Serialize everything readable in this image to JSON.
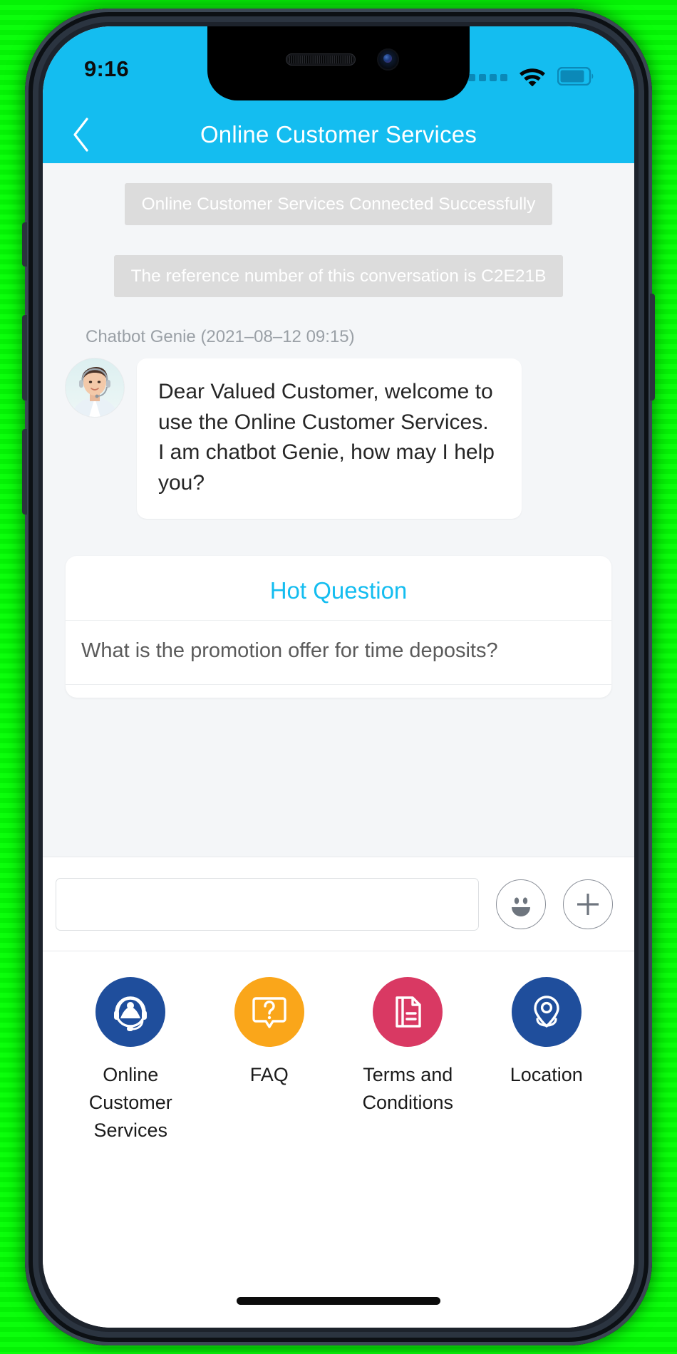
{
  "colors": {
    "brand": "#14bdf0",
    "brand_hot": "#14bdf0",
    "sys_pill_bg": "#dcdcdc",
    "chat_bg": "#f4f6f8",
    "tool_blue": "#1f4e9c",
    "tool_orange": "#faa61a",
    "tool_pink": "#d93963",
    "tool_navy": "#1f4e9c"
  },
  "statusbar": {
    "clock": "9:16",
    "cellular_icon": "cellular-dots-icon",
    "cellular_bars": 4,
    "wifi_icon": "wifi-icon",
    "battery_icon": "battery-icon"
  },
  "navbar": {
    "back_icon": "chevron-left-icon",
    "title": "Online Customer Services"
  },
  "chat": {
    "system_messages": [
      "Online Customer Services Connected Successfully",
      "The reference number of this conversation is C2E21B"
    ],
    "messages": [
      {
        "meta": "Chatbot Genie (2021–08–12 09:15)",
        "avatar_icon": "agent-avatar",
        "text": "Dear Valued Customer, welcome to use the Online Customer Services. I am chatbot Genie, how may I help you?"
      }
    ],
    "hot_question": {
      "title": "Hot Question",
      "items": [
        "What is the promotion offer for time deposits?"
      ]
    }
  },
  "composer": {
    "input_value": "",
    "input_placeholder": "",
    "emoji_icon": "smiley-face-icon",
    "add_icon": "plus-circle-icon"
  },
  "tools": [
    {
      "label": "Online Customer Services",
      "icon": "headset-agent-icon",
      "color": "#1f4e9c"
    },
    {
      "label": "FAQ",
      "icon": "question-speech-bubble-icon",
      "color": "#faa61a"
    },
    {
      "label": "Terms and Conditions",
      "icon": "document-icon",
      "color": "#d93963"
    },
    {
      "label": "Location",
      "icon": "map-pin-icon",
      "color": "#1f4e9c"
    }
  ]
}
